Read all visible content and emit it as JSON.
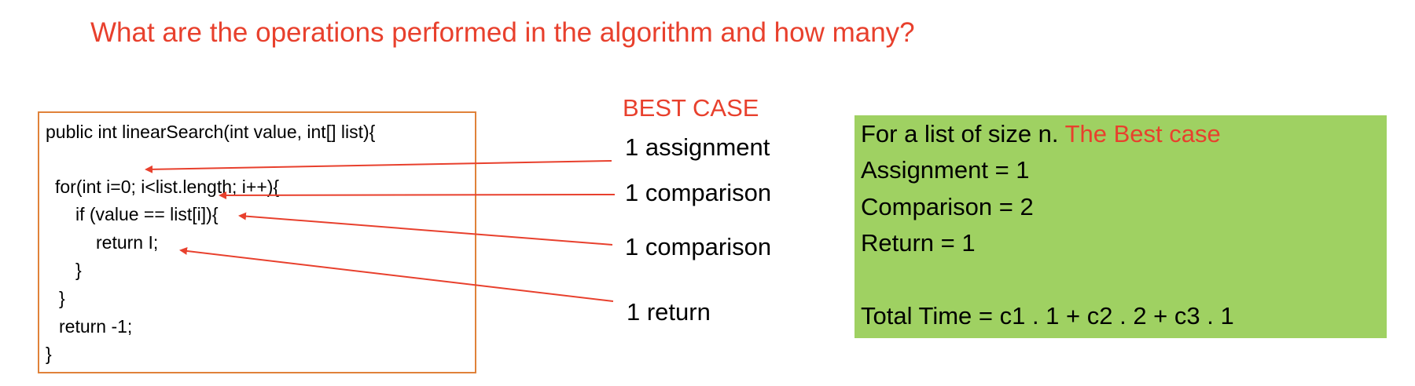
{
  "colors": {
    "accent_red": "#e8402d",
    "box_border_orange": "#e0823a",
    "summary_green": "#9fd162",
    "text": "#000000"
  },
  "title": "What are the operations performed in the algorithm and how many?",
  "code": {
    "lines": [
      "public int linearSearch(int value, int[] list){",
      "for(int i=0; i<list.length; i++){",
      "if (value == list[i]){",
      "return I;",
      "}",
      "}",
      "return -1;",
      "}"
    ]
  },
  "best_case": {
    "heading": "BEST CASE",
    "operations": [
      "1 assignment",
      "1 comparison",
      "1 comparison",
      "1 return"
    ]
  },
  "summary": {
    "intro": "For a list of size n.",
    "highlight": "The Best case",
    "assignment": "Assignment = 1",
    "comparison": "Comparison = 2",
    "return_count": "Return = 1",
    "total": "Total Time = c1 . 1 + c2 . 2 + c3 . 1"
  }
}
